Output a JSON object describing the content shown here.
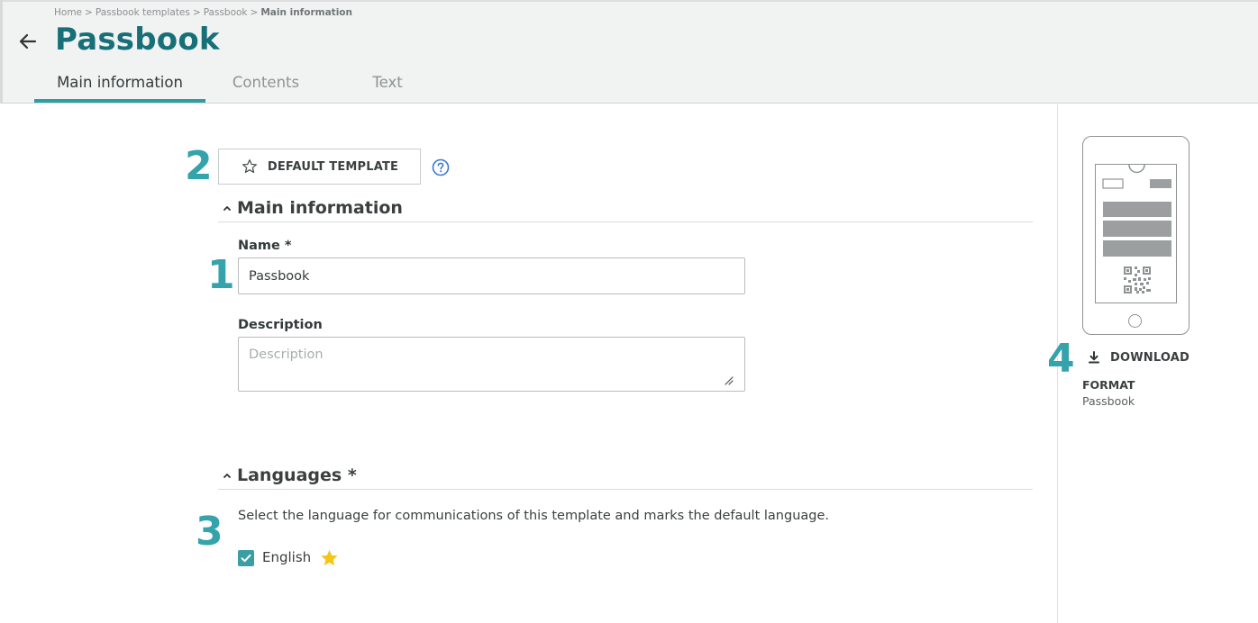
{
  "breadcrumb": [
    "Home",
    "Passbook templates",
    "Passbook",
    "Main information"
  ],
  "page": {
    "title": "Passbook"
  },
  "tabs": [
    {
      "label": "Main information",
      "active": true
    },
    {
      "label": "Contents",
      "active": false
    },
    {
      "label": "Text",
      "active": false
    }
  ],
  "steps": [
    "1",
    "2",
    "3",
    "4"
  ],
  "default_template": {
    "label": "DEFAULT TEMPLATE",
    "icon": "star-outline-icon"
  },
  "main_section": {
    "title": "Main information",
    "name_label": "Name *",
    "name_value": "Passbook",
    "description_label": "Description",
    "description_placeholder": "Description",
    "description_value": ""
  },
  "languages_section": {
    "title": "Languages *",
    "description": "Select the language for communications of this template and marks the default language.",
    "languages": [
      {
        "label": "English",
        "checked": true,
        "default": true
      }
    ]
  },
  "preview": {
    "download_label": "DOWNLOAD",
    "format_label": "FORMAT",
    "format_value": "Passbook"
  },
  "colors": {
    "brand_title": "#176f78",
    "accent": "#2e9ea0",
    "step_number": "#34a3ab",
    "checkbox": "#3a9ea5",
    "default_star": "#f5c518"
  }
}
